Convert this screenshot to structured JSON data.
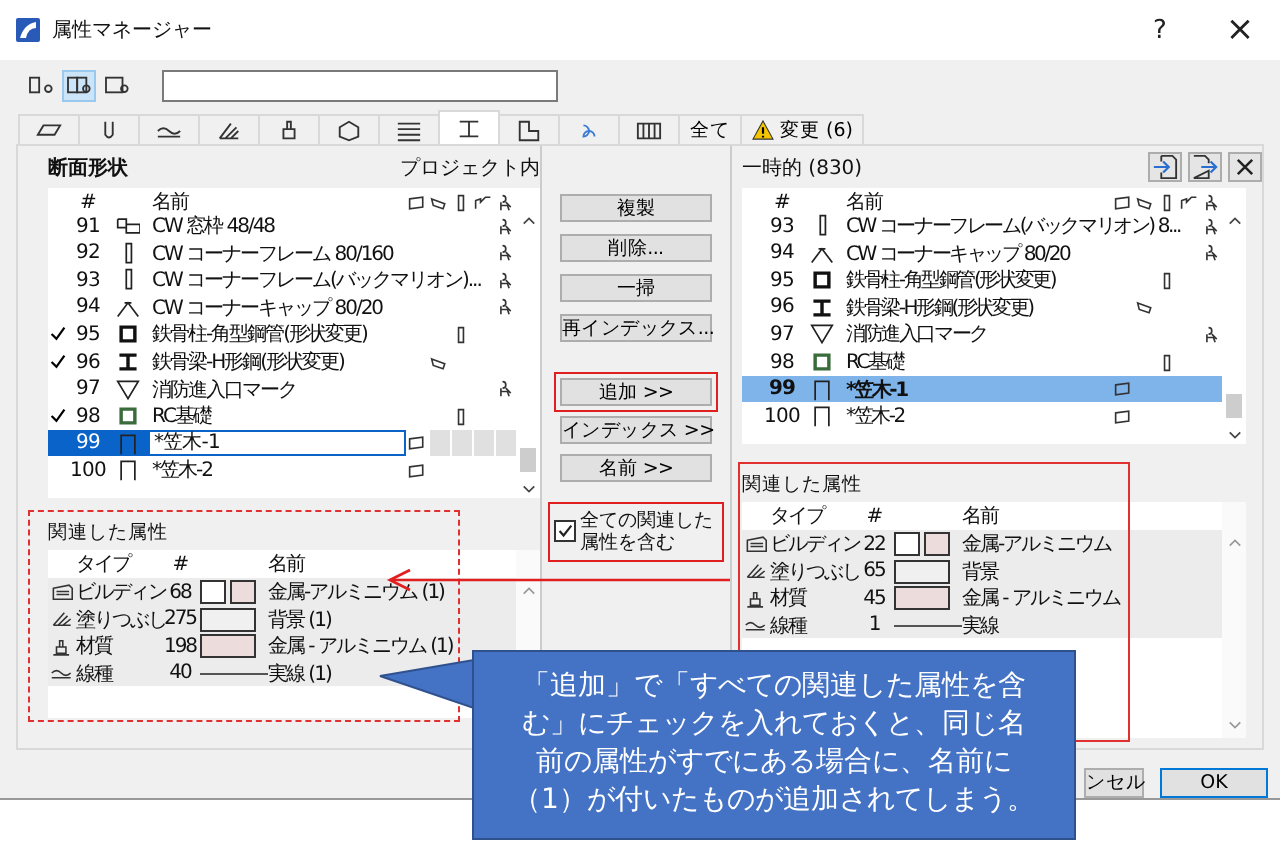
{
  "window": {
    "title": "属性マネージャー",
    "help": "?",
    "close": "×"
  },
  "view_buttons": [
    {
      "selected": false
    },
    {
      "selected": true
    },
    {
      "selected": false
    }
  ],
  "tabs": [
    {
      "kind": "icon",
      "selected": false
    },
    {
      "kind": "icon",
      "selected": false
    },
    {
      "kind": "icon",
      "selected": false
    },
    {
      "kind": "icon",
      "selected": false
    },
    {
      "kind": "icon",
      "selected": false
    },
    {
      "kind": "icon",
      "selected": false
    },
    {
      "kind": "icon",
      "selected": false
    },
    {
      "kind": "icon",
      "selected": true
    },
    {
      "kind": "icon",
      "selected": false
    },
    {
      "kind": "icon",
      "selected": false
    },
    {
      "kind": "icon",
      "selected": false
    },
    {
      "kind": "text",
      "label": "全て",
      "selected": false
    },
    {
      "kind": "warning",
      "label": "変更 (6)",
      "selected": false
    }
  ],
  "project_pane": {
    "title": "断面形状",
    "subtitle": "プロジェクト内",
    "columns": [
      "#",
      "名前"
    ],
    "rows": [
      {
        "checked": false,
        "selected": false,
        "kind": "frame",
        "index": "91",
        "name": "CW 窓枠 48/48",
        "usage": {
          "kind": "column_5"
        }
      },
      {
        "checked": false,
        "selected": false,
        "kind": "pipe",
        "index": "92",
        "name": "CW コーナーフレーム 80/160",
        "usage": {
          "kind": "column_5"
        }
      },
      {
        "checked": false,
        "selected": false,
        "kind": "pipe",
        "index": "93",
        "name": "CW コーナーフレーム(バックマリオン)...",
        "usage": {
          "kind": "column_5"
        }
      },
      {
        "checked": false,
        "selected": false,
        "kind": "cap",
        "index": "94",
        "name": "CW コーナーキャップ 80/20",
        "usage": {
          "kind": "column_5"
        }
      },
      {
        "checked": true,
        "selected": false,
        "kind": "box",
        "index": "95",
        "name": "鉄骨柱-角型鋼管(形状変更)",
        "usage": {
          "kind": "column_3"
        }
      },
      {
        "checked": true,
        "selected": false,
        "kind": "ibeam",
        "index": "96",
        "name": "鉄骨梁-H形鋼(形状変更)",
        "usage": {
          "kind": "column_2"
        }
      },
      {
        "checked": false,
        "selected": false,
        "kind": "triangle",
        "index": "97",
        "name": "消防進入口マーク",
        "usage": {
          "kind": "column_5"
        }
      },
      {
        "checked": true,
        "selected": false,
        "kind": "square",
        "index": "98",
        "name": "RC基礎",
        "usage": {
          "kind": "column_3"
        }
      },
      {
        "checked": false,
        "selected": true,
        "editing": true,
        "kind": "bracket",
        "index": "99",
        "name": "*笠木-1",
        "usage": {
          "kind": "column_1"
        }
      },
      {
        "checked": false,
        "selected": false,
        "kind": "bracket",
        "index": "100",
        "name": "*笠木-2",
        "usage": {
          "kind": "column_1"
        }
      }
    ],
    "related": {
      "title": "関連した属性",
      "highlighted": true,
      "columns": [
        "タイプ",
        "#",
        "名前"
      ],
      "rows": [
        {
          "kind": "building",
          "type": "ビルディン",
          "index": "68",
          "name": "金属-アルミニウム (1)"
        },
        {
          "kind": "fill",
          "type": "塗りつぶし",
          "index": "275",
          "name": "背景 (1)"
        },
        {
          "kind": "material",
          "type": "材質",
          "index": "198",
          "name": "金属 - アルミニウム (1)"
        },
        {
          "kind": "line",
          "type": "線種",
          "index": "40",
          "name": "実線 (1)"
        }
      ]
    }
  },
  "actions": [
    "複製",
    "削除...",
    "一掃",
    "再インデックス..."
  ],
  "transfer_actions": [
    {
      "label": "追加 >>",
      "highlighted": true
    },
    {
      "label": "インデックス >>",
      "highlighted": false
    },
    {
      "label": "名前 >>",
      "highlighted": false
    }
  ],
  "include_related": {
    "label": "全ての関連した属性を含む",
    "checked": true,
    "highlighted": true
  },
  "temp_pane": {
    "title": "一時的 (830)",
    "columns": [
      "#",
      "名前"
    ],
    "rows": [
      {
        "selected": false,
        "kind": "pipe",
        "index": "93",
        "name": "CW コーナーフレーム(バックマリオン) 8...",
        "usage": {
          "kind": "column_5"
        }
      },
      {
        "selected": false,
        "kind": "cap",
        "index": "94",
        "name": "CW コーナーキャップ 80/20",
        "usage": {
          "kind": "column_5"
        }
      },
      {
        "selected": false,
        "kind": "box",
        "index": "95",
        "name": "鉄骨柱-角型鋼管(形状変更)",
        "usage": {
          "kind": "column_3"
        }
      },
      {
        "selected": false,
        "kind": "ibeam",
        "index": "96",
        "name": "鉄骨梁-H形鋼(形状変更)",
        "usage": {
          "kind": "column_2"
        }
      },
      {
        "selected": false,
        "kind": "triangle",
        "index": "97",
        "name": "消防進入口マーク",
        "usage": {
          "kind": "column_5"
        }
      },
      {
        "selected": false,
        "kind": "square",
        "index": "98",
        "name": "RC基礎",
        "usage": {
          "kind": "column_3"
        }
      },
      {
        "selected": true,
        "kind": "bracket",
        "index": "99",
        "name": "*笠木-1",
        "usage": {
          "kind": "column_1"
        }
      },
      {
        "selected": false,
        "kind": "bracket",
        "index": "100",
        "name": "*笠木-2",
        "usage": {
          "kind": "column_1"
        }
      }
    ],
    "related": {
      "title": "関連した属性",
      "highlighted": true,
      "columns": [
        "タイプ",
        "#",
        "名前"
      ],
      "rows": [
        {
          "kind": "building",
          "type": "ビルディン",
          "index": "22",
          "name": "金属-アルミニウム"
        },
        {
          "kind": "fill",
          "type": "塗りつぶし",
          "index": "65",
          "name": "背景"
        },
        {
          "kind": "material",
          "type": "材質",
          "index": "45",
          "name": "金属 - アルミニウム"
        },
        {
          "kind": "line",
          "type": "線種",
          "index": "1",
          "name": "実線"
        }
      ]
    }
  },
  "footer_buttons": [
    {
      "label": "ンセル",
      "default": false
    },
    {
      "label": "OK",
      "default": true
    }
  ],
  "callout": {
    "text": "「追加」で「すべての関連した属性を含む」にチェックを入れておくと、同じ名前の属性がすでにある場合に、名前に（1）が付いたものが追加されてしまう。"
  }
}
